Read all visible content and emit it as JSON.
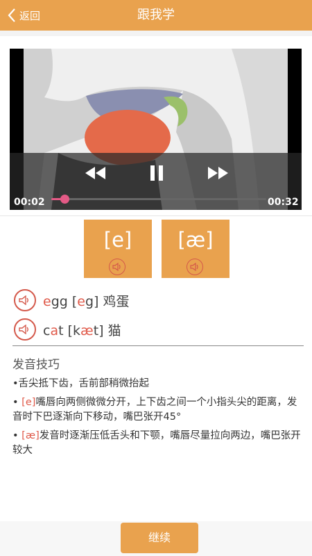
{
  "header": {
    "back_label": "返回",
    "title": "跟我学"
  },
  "video": {
    "current_time": "00:02",
    "duration": "00:32",
    "progress": 0.06
  },
  "phonemes": [
    {
      "symbol": "[e]",
      "audio_icon": "speaker-icon"
    },
    {
      "symbol": "[æ]",
      "audio_icon": "speaker-icon"
    }
  ],
  "words": [
    {
      "pre": "",
      "hl": "e",
      "post": "gg [",
      "ph_pre": "",
      "ph_hl": "e",
      "ph_post": "g] 鸡蛋"
    },
    {
      "pre": "c",
      "hl": "a",
      "post": "t [k",
      "ph_pre": "",
      "ph_hl": "æ",
      "ph_post": "t] 猫"
    }
  ],
  "tips": {
    "title": "发音技巧",
    "items": [
      {
        "prefix": "",
        "text": "•舌尖抵下齿，舌前部稍微抬起"
      },
      {
        "prefix": "[e]",
        "text": "嘴唇向两侧微微分开，上下齿之间一个小指头尖的距离，发音时下巴逐渐向下移动，嘴巴张开45°"
      },
      {
        "prefix": "[æ]",
        "text": "发音时逐渐压低舌头和下颚，嘴唇尽量拉向两边，嘴巴张开较大"
      }
    ]
  },
  "continue_label": "继续",
  "colors": {
    "accent": "#e9a24e",
    "highlight": "#e05a4a",
    "progress": "#e45a86"
  }
}
